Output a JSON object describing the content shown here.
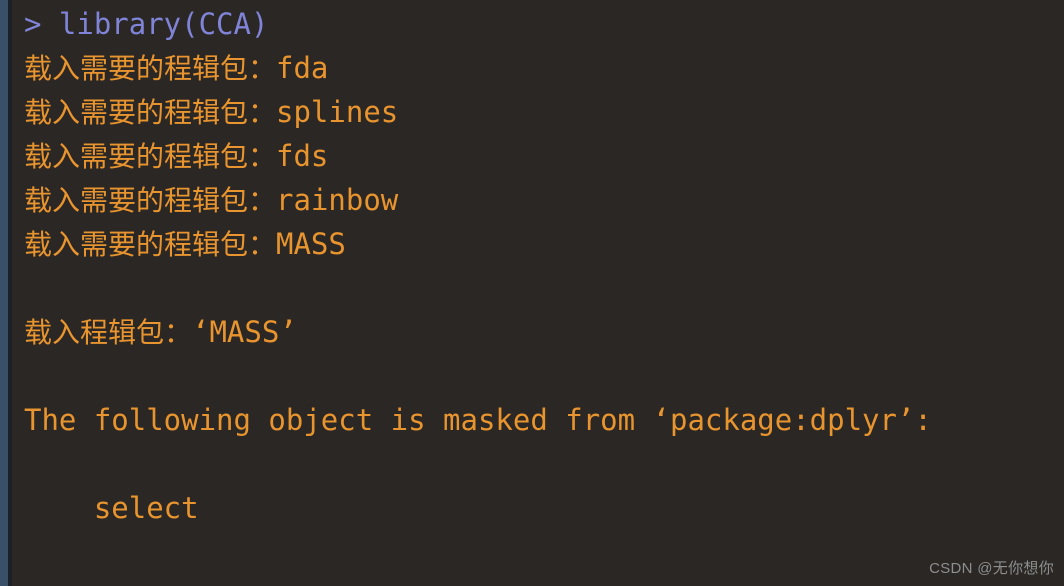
{
  "terminal": {
    "background_color": "#2b2724",
    "gutter_color": "#3a5068",
    "gutter_shadow_color": "#1b2029",
    "prompt_color": "#8084d8",
    "output_color": "#e8942f",
    "lines": [
      {
        "id": "l1",
        "kind": "prompt",
        "text": "> library(CCA)"
      },
      {
        "id": "l2",
        "kind": "output",
        "cjk": "载入需要的程辑包：",
        "text": "fda"
      },
      {
        "id": "l3",
        "kind": "output",
        "cjk": "载入需要的程辑包：",
        "text": "splines"
      },
      {
        "id": "l4",
        "kind": "output",
        "cjk": "载入需要的程辑包：",
        "text": "fds"
      },
      {
        "id": "l5",
        "kind": "output",
        "cjk": "载入需要的程辑包：",
        "text": "rainbow"
      },
      {
        "id": "l6",
        "kind": "output",
        "cjk": "载入需要的程辑包：",
        "text": "MASS"
      },
      {
        "id": "l7",
        "kind": "blank",
        "text": ""
      },
      {
        "id": "l8",
        "kind": "output",
        "cjk": "载入程辑包：",
        "text": "‘MASS’"
      },
      {
        "id": "l9",
        "kind": "blank",
        "text": ""
      },
      {
        "id": "l10",
        "kind": "output",
        "text": "The following object is masked from ‘package:dplyr’:"
      },
      {
        "id": "l11",
        "kind": "blank",
        "text": ""
      },
      {
        "id": "l12",
        "kind": "output",
        "text": "    select"
      }
    ]
  },
  "watermark": {
    "text": "CSDN @无你想你"
  }
}
